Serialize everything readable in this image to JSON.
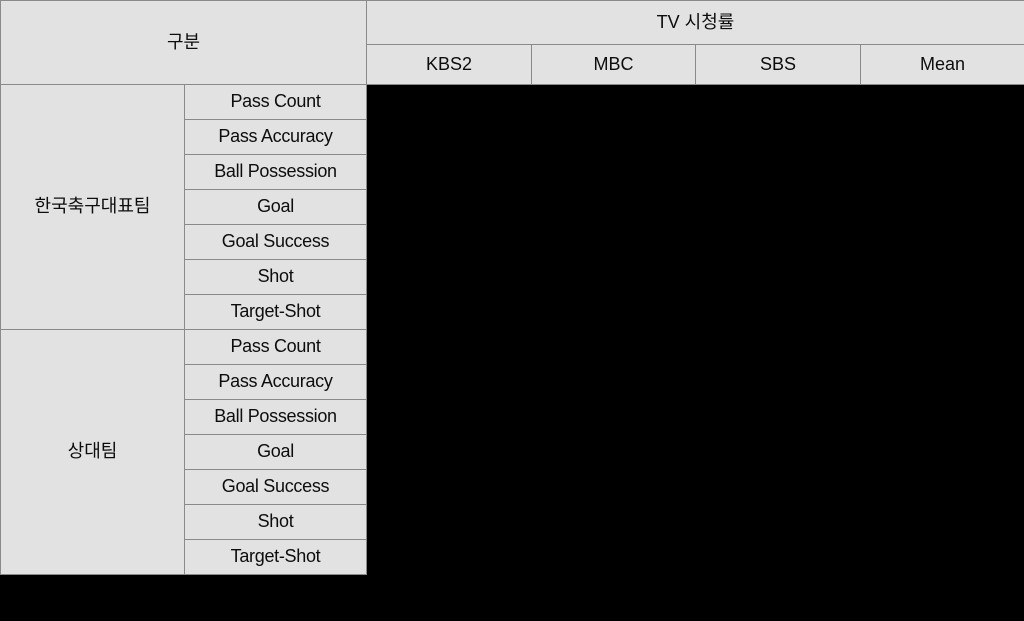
{
  "table": {
    "header": {
      "left_label": "구분",
      "span_group_label": "TV 시청률",
      "channel_columns": [
        "KBS2",
        "MBC",
        "SBS",
        "Mean"
      ]
    },
    "groups": [
      {
        "name": "한국축구대표팀",
        "metrics": [
          "Pass Count",
          "Pass Accuracy",
          "Ball Possession",
          "Goal",
          "Goal Success",
          "Shot",
          "Target-Shot"
        ]
      },
      {
        "name": "상대팀",
        "metrics": [
          "Pass Count",
          "Pass Accuracy",
          "Ball Possession",
          "Goal",
          "Goal Success",
          "Shot",
          "Target-Shot"
        ]
      }
    ],
    "values": {
      "note": "",
      "rows": [
        {
          "KBS2": "",
          "MBC": "",
          "SBS": "",
          "Mean": ""
        },
        {
          "KBS2": "",
          "MBC": "",
          "SBS": "",
          "Mean": ""
        },
        {
          "KBS2": "",
          "MBC": "",
          "SBS": "",
          "Mean": ""
        },
        {
          "KBS2": "",
          "MBC": "",
          "SBS": "",
          "Mean": ""
        },
        {
          "KBS2": "",
          "MBC": "",
          "SBS": "",
          "Mean": ""
        },
        {
          "KBS2": "",
          "MBC": "",
          "SBS": "",
          "Mean": ""
        },
        {
          "KBS2": "",
          "MBC": "",
          "SBS": "",
          "Mean": ""
        },
        {
          "KBS2": "",
          "MBC": "",
          "SBS": "",
          "Mean": ""
        },
        {
          "KBS2": "",
          "MBC": "",
          "SBS": "",
          "Mean": ""
        },
        {
          "KBS2": "",
          "MBC": "",
          "SBS": "",
          "Mean": ""
        },
        {
          "KBS2": "",
          "MBC": "",
          "SBS": "",
          "Mean": ""
        },
        {
          "KBS2": "",
          "MBC": "",
          "SBS": "",
          "Mean": ""
        },
        {
          "KBS2": "",
          "MBC": "",
          "SBS": "",
          "Mean": ""
        },
        {
          "KBS2": "",
          "MBC": "",
          "SBS": "",
          "Mean": ""
        }
      ]
    }
  },
  "colors": {
    "cell_fill": "#E2E2E2",
    "grid_line": "#8A8A8A",
    "frame_line": "#000000",
    "text": "#0D0D0D",
    "background": "#000000"
  }
}
